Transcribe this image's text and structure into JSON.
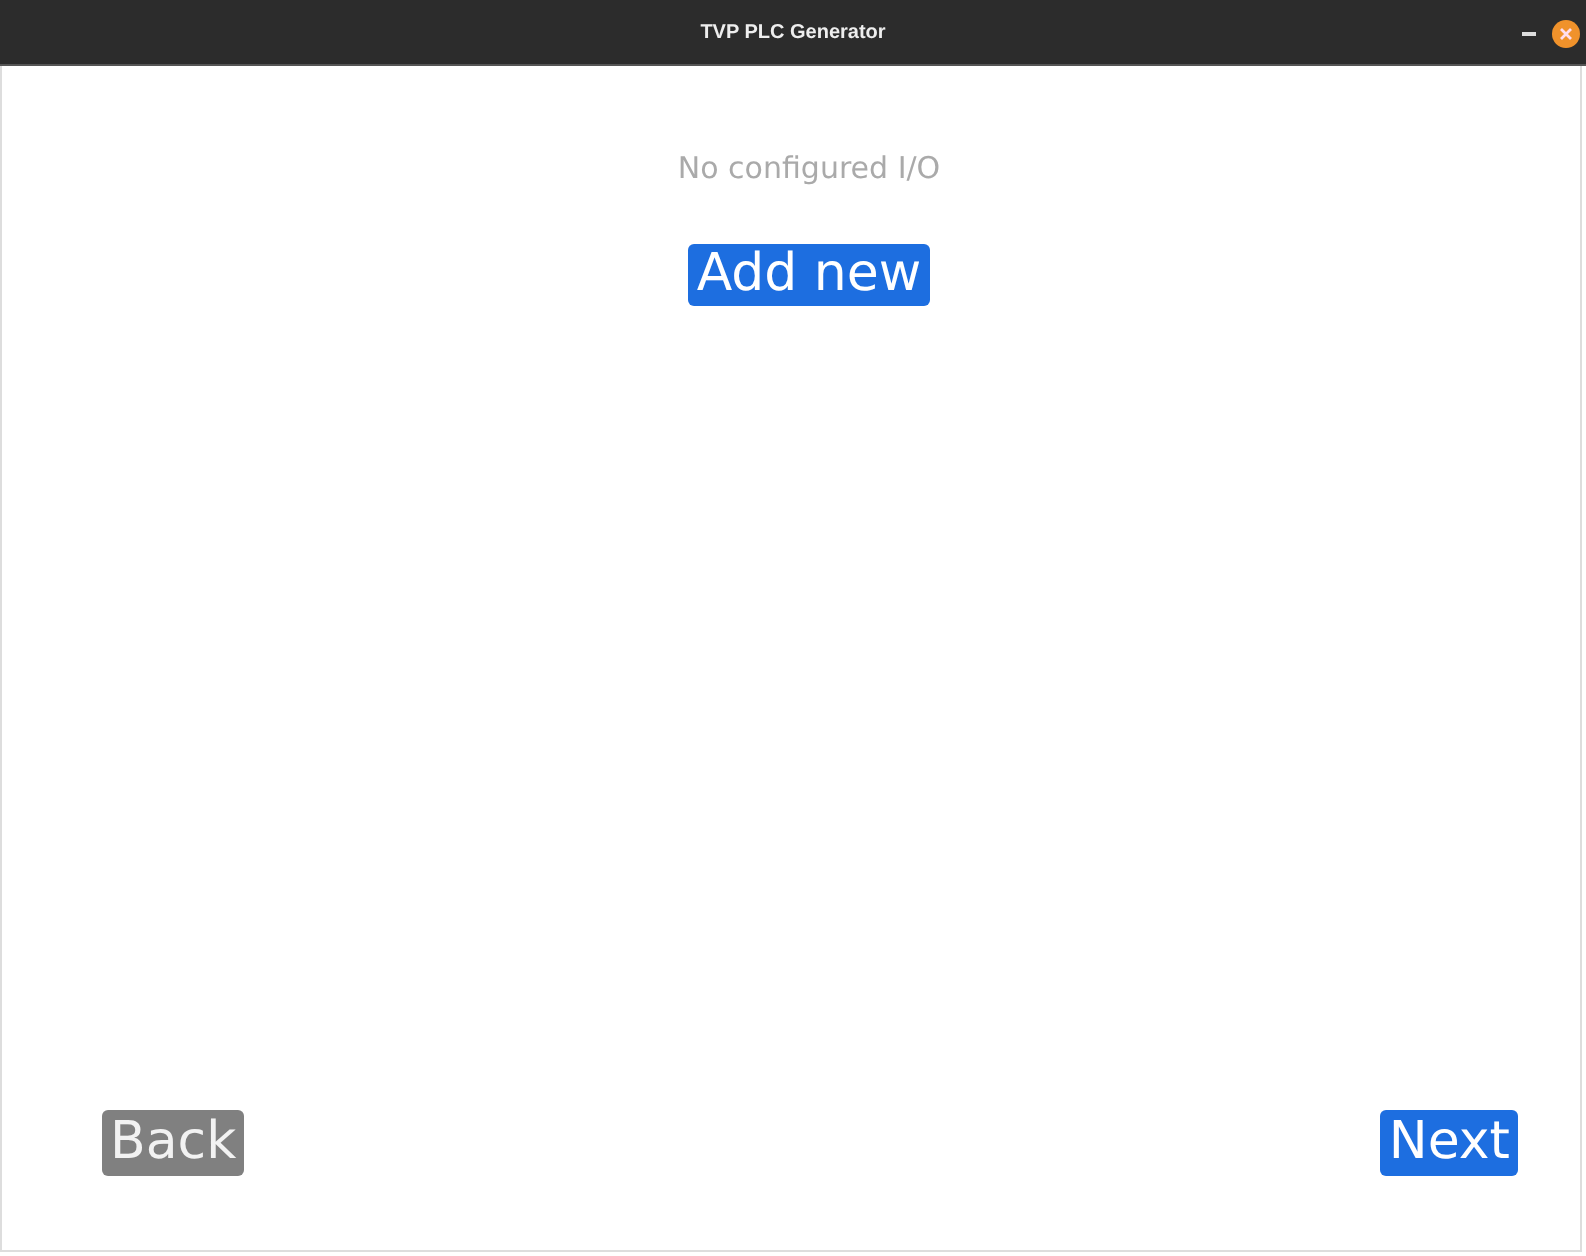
{
  "window": {
    "title": "TVP PLC Generator"
  },
  "message": "No configured I/O",
  "add_button": {
    "label": "Add new"
  },
  "nav_buttons": [
    {
      "label": "Back",
      "kind": "secondary"
    },
    {
      "label": "Next",
      "kind": "primary"
    }
  ]
}
